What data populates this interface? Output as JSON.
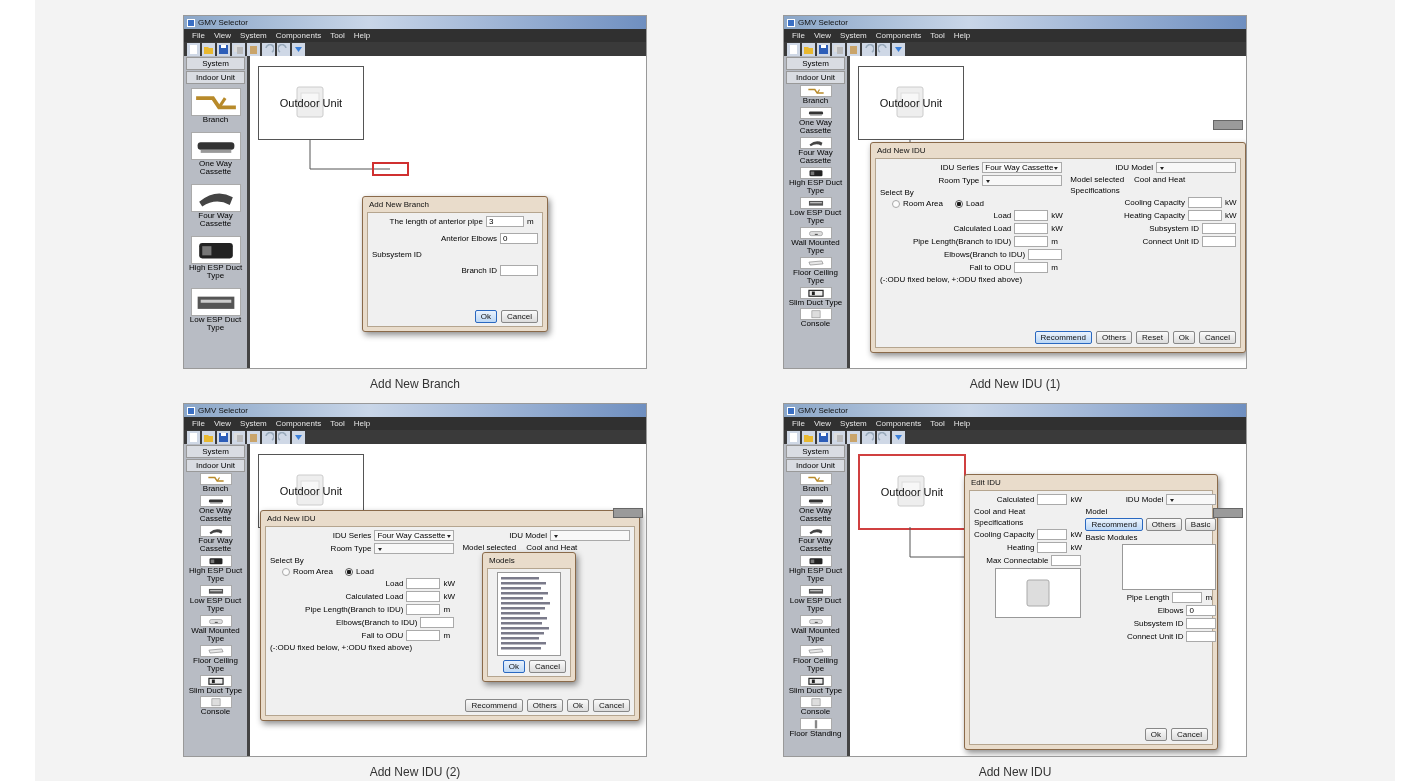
{
  "panels": [
    {
      "caption": "Add New Branch",
      "window": {
        "title": "GMV Selector",
        "menu": [
          "File",
          "View",
          "System",
          "Components",
          "Tool",
          "Help"
        ]
      },
      "sidebar": {
        "tabs": [
          "System",
          "Indoor Unit"
        ],
        "items": [
          "Branch",
          "One Way Cassette",
          "Four Way Cassette",
          "High ESP Duct Type",
          "Low ESP Duct Type"
        ]
      },
      "canvas": {
        "unit_label": "Outdoor Unit",
        "unit_selected": false,
        "pending_branch": true
      },
      "dialogs": [
        {
          "kind": "branch",
          "title": "Add New Branch",
          "left": [
            {
              "kind": "field",
              "label": "The length of anterior pipe",
              "value": "3",
              "unit": "m"
            },
            {
              "kind": "field",
              "label": "Anterior Elbows",
              "value": "0"
            },
            {
              "kind": "text",
              "label": "Subsystem ID"
            },
            {
              "kind": "field",
              "label": "Branch ID"
            }
          ],
          "buttons": [
            {
              "label": "Ok",
              "default": true
            },
            {
              "label": "Cancel",
              "default": false
            }
          ]
        }
      ]
    },
    {
      "caption": "Add New IDU (1)",
      "window": {
        "title": "GMV Selector",
        "menu": [
          "File",
          "View",
          "System",
          "Components",
          "Tool",
          "Help"
        ]
      },
      "sidebar": {
        "tabs": [
          "System",
          "Indoor Unit"
        ],
        "items": [
          "Branch",
          "One Way Cassette",
          "Four Way Cassette",
          "High ESP Duct Type",
          "Low ESP Duct Type",
          "Wall Mounted Type",
          "Floor Ceiling Type",
          "Slim Duct Type",
          "Console"
        ]
      },
      "canvas": {
        "unit_label": "Outdoor Unit",
        "unit_selected": false,
        "floating_panel": true
      },
      "dialogs": [
        {
          "kind": "idu",
          "title": "Add New IDU",
          "left": [
            {
              "kind": "select",
              "label": "IDU Series",
              "value": "Four Way Cassette"
            },
            {
              "kind": "select",
              "label": "Room Type"
            },
            {
              "kind": "text",
              "label": "Select By"
            },
            {
              "kind": "radio",
              "options": [
                {
                  "label": "Room Area",
                  "selected": false
                },
                {
                  "label": "Load",
                  "selected": true
                }
              ]
            },
            {
              "kind": "field",
              "label": "Load",
              "unit": "kW"
            },
            {
              "kind": "field",
              "label": "Calculated Load",
              "unit": "kW"
            },
            {
              "kind": "field",
              "label": "Pipe Length(Branch to IDU)",
              "unit": "m"
            },
            {
              "kind": "field",
              "label": "Elbows(Branch to IDU)"
            },
            {
              "kind": "field",
              "label": "Fall to ODU",
              "unit": "m"
            },
            {
              "kind": "note",
              "label": "(-:ODU fixed below, +:ODU fixed above)"
            }
          ],
          "right": [
            {
              "kind": "select",
              "label": "IDU Model"
            },
            {
              "kind": "text",
              "label": "Model selected",
              "value": "Cool and Heat"
            },
            {
              "kind": "text",
              "label": "Specifications"
            },
            {
              "kind": "field",
              "label": "Cooling Capacity",
              "unit": "kW"
            },
            {
              "kind": "field",
              "label": "Heating Capacity",
              "unit": "kW"
            },
            {
              "kind": "field",
              "label": "Subsystem ID"
            },
            {
              "kind": "field",
              "label": "Connect Unit ID"
            }
          ],
          "buttons": [
            {
              "label": "Recommend",
              "default": true
            },
            {
              "label": "Others",
              "default": false
            },
            {
              "label": "Reset",
              "default": false
            },
            {
              "label": "Ok",
              "default": false
            },
            {
              "label": "Cancel",
              "default": false
            }
          ]
        }
      ]
    },
    {
      "caption": "Add New IDU (2)",
      "window": {
        "title": "GMV Selector",
        "menu": [
          "File",
          "View",
          "System",
          "Components",
          "Tool",
          "Help"
        ]
      },
      "sidebar": {
        "tabs": [
          "System",
          "Indoor Unit"
        ],
        "items": [
          "Branch",
          "One Way Cassette",
          "Four Way Cassette",
          "High ESP Duct Type",
          "Low ESP Duct Type",
          "Wall Mounted Type",
          "Floor Ceiling Type",
          "Slim Duct Type",
          "Console"
        ]
      },
      "canvas": {
        "unit_label": "Outdoor Unit",
        "unit_selected": false,
        "floating_panel": true
      },
      "dialogs": [
        {
          "kind": "idu",
          "title": "Add New IDU",
          "left": [
            {
              "kind": "select",
              "label": "IDU Series",
              "value": "Four Way Cassette"
            },
            {
              "kind": "select",
              "label": "Room Type"
            },
            {
              "kind": "text",
              "label": "Select By"
            },
            {
              "kind": "radio",
              "options": [
                {
                  "label": "Room Area",
                  "selected": false
                },
                {
                  "label": "Load",
                  "selected": true
                }
              ]
            },
            {
              "kind": "field",
              "label": "Load",
              "unit": "kW"
            },
            {
              "kind": "field",
              "label": "Calculated Load",
              "unit": "kW"
            },
            {
              "kind": "field",
              "label": "Pipe Length(Branch to IDU)",
              "unit": "m"
            },
            {
              "kind": "field",
              "label": "Elbows(Branch to IDU)"
            },
            {
              "kind": "field",
              "label": "Fall to ODU",
              "unit": "m"
            },
            {
              "kind": "note",
              "label": "(-:ODU fixed below, +:ODU fixed above)"
            }
          ],
          "right": [
            {
              "kind": "select",
              "label": "IDU Model"
            },
            {
              "kind": "text",
              "label": "Model selected",
              "value": "Cool and Heat"
            }
          ],
          "buttons": [
            {
              "label": "Recommend",
              "default": false
            },
            {
              "label": "Others",
              "default": false
            },
            {
              "label": "Ok",
              "default": false
            },
            {
              "label": "Cancel",
              "default": false
            }
          ]
        },
        {
          "kind": "models",
          "title": "Models",
          "left": [
            {
              "kind": "listbox"
            }
          ],
          "buttons": [
            {
              "label": "Ok",
              "default": true
            },
            {
              "label": "Cancel",
              "default": false
            }
          ]
        }
      ]
    },
    {
      "caption": "Add New IDU",
      "window": {
        "title": "GMV Selector",
        "menu": [
          "File",
          "View",
          "System",
          "Components",
          "Tool",
          "Help"
        ]
      },
      "sidebar": {
        "tabs": [
          "System",
          "Indoor Unit"
        ],
        "items": [
          "Branch",
          "One Way Cassette",
          "Four Way Cassette",
          "High ESP Duct Type",
          "Low ESP Duct Type",
          "Wall Mounted Type",
          "Floor Ceiling Type",
          "Slim Duct Type",
          "Console",
          "Floor Standing"
        ]
      },
      "canvas": {
        "unit_label": "Outdoor Unit",
        "unit_selected": true,
        "floating_panel": true
      },
      "dialogs": [
        {
          "kind": "edit",
          "title": "Edit IDU",
          "left": [
            {
              "kind": "field",
              "label": "Calculated",
              "unit": "kW"
            },
            {
              "kind": "text",
              "label": "Cool and Heat"
            },
            {
              "kind": "text",
              "label": "Specifications"
            },
            {
              "kind": "field",
              "label": "Cooling Capacity",
              "unit": "kW"
            },
            {
              "kind": "field",
              "label": "Heating",
              "unit": "kW"
            },
            {
              "kind": "field",
              "label": "Max Connectable"
            },
            {
              "kind": "photo"
            }
          ],
          "right": [
            {
              "kind": "select",
              "label": "IDU Model"
            },
            {
              "kind": "text",
              "label": "Model"
            },
            {
              "kind": "buttons3",
              "options": [
                {
                  "label": "Recommend",
                  "selected": true
                },
                {
                  "label": "Others",
                  "selected": false
                },
                {
                  "label": "Basic",
                  "selected": false
                }
              ]
            },
            {
              "kind": "text",
              "label": "Basic Modules"
            },
            {
              "kind": "listbox"
            },
            {
              "kind": "field",
              "label": "Pipe Length",
              "unit": "m"
            },
            {
              "kind": "field",
              "label": "Elbows",
              "value": "0"
            },
            {
              "kind": "field",
              "label": "Subsystem ID"
            },
            {
              "kind": "field",
              "label": "Connect Unit ID"
            }
          ],
          "buttons": [
            {
              "label": "Ok",
              "default": false
            },
            {
              "label": "Cancel",
              "default": false
            }
          ]
        }
      ]
    }
  ]
}
